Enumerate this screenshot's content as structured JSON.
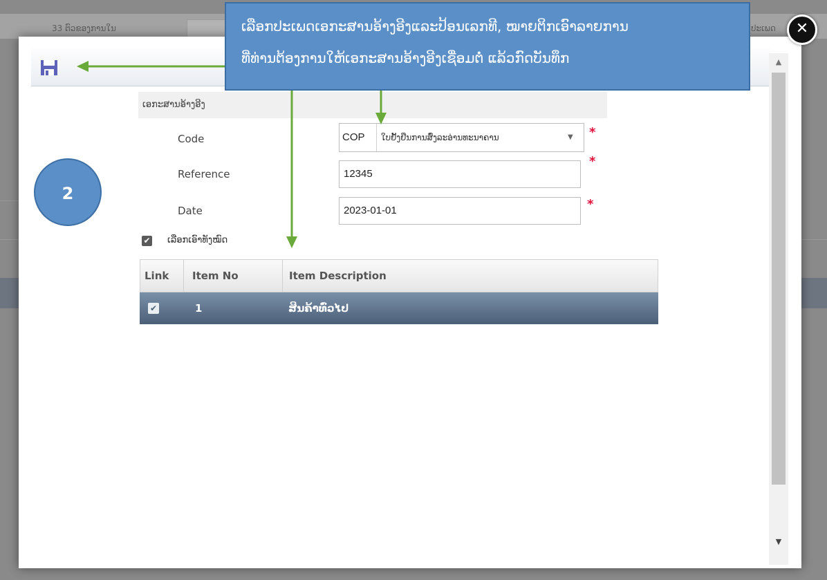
{
  "background": {
    "left_text": "33 ຕົວຂອງການໃນ",
    "right_text": "ປະເພດ"
  },
  "toolbar": {
    "save_icon": "floppy-disk-icon"
  },
  "form": {
    "section_title": "ເອກະສານອ້າງອີງ",
    "code_label": "Code",
    "code_value": "COP",
    "code_description": "ໃບຢັ້ງຢືນການສົ່ງລະອ່ານທະນາຄານ",
    "reference_label": "Reference",
    "reference_value": "12345",
    "date_label": "Date",
    "date_value": "2023-01-01",
    "required_mark": "*",
    "select_all_label": "ເລືອກເອົາທັງໝົດ"
  },
  "grid": {
    "columns": [
      "Link",
      "Item No",
      "Item Description"
    ],
    "rows": [
      {
        "checked": true,
        "item_no": "1",
        "description": "ສິນຄ້າທົ່ວໄປ"
      }
    ]
  },
  "annotation": {
    "step_number": "2",
    "callout_line1": "ເລືອກປະເພດເອກະສານອ້າງອີງແລະປ້ອນເລກທີ, ໝາຍຕິກເອົາລາຍການ",
    "callout_line2": "ທີ່ທ່ານຕ້ອງການໃຫ້ເອກະສານອ້າງອີງເຊື່ອມຕໍ່ ແລ້ວກົດບັນທຶກ"
  },
  "colors": {
    "accent": "#5b8fc7",
    "arrow": "#6aaa3a",
    "required": "#e0103a",
    "selected_row": "#566a82"
  }
}
